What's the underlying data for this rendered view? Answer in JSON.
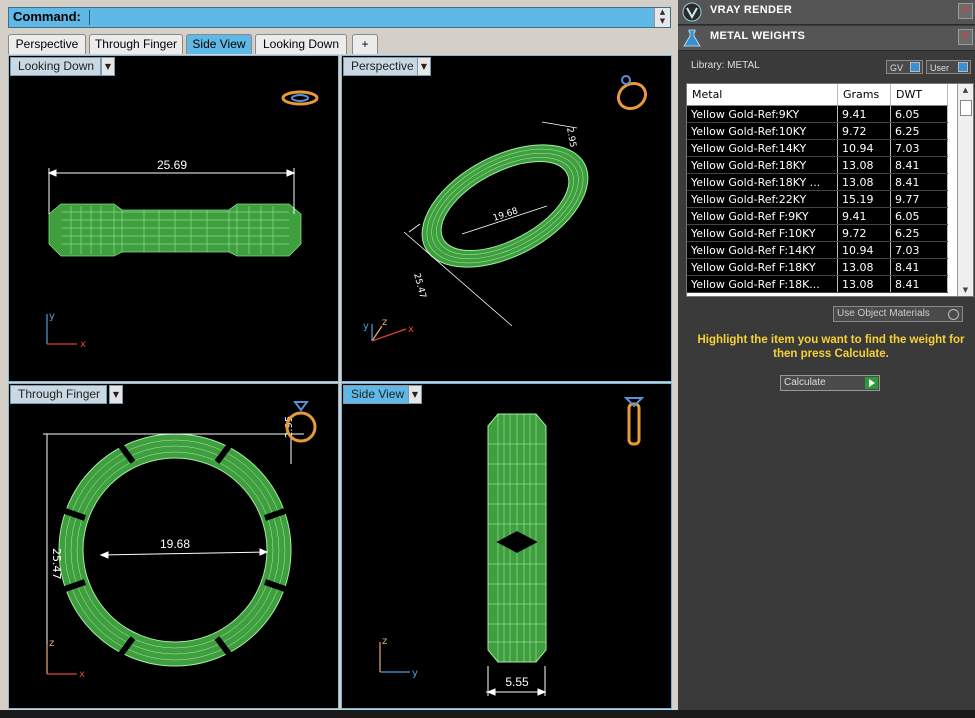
{
  "command": {
    "label": "Command:",
    "value": ""
  },
  "tabs": [
    "Perspective",
    "Through Finger",
    "Side View",
    "Looking Down",
    "+"
  ],
  "active_tab": "Side View",
  "viewports": {
    "top_left": {
      "label": "Looking Down",
      "dimension": "25.69",
      "axes": [
        "y",
        "x"
      ]
    },
    "top_right": {
      "label": "Perspective",
      "dimensions": [
        "19.68",
        "2.95",
        "25.47"
      ],
      "axes": [
        "y",
        "z",
        "x"
      ]
    },
    "bottom_left": {
      "label": "Through Finger",
      "dimensions": [
        "19.68",
        "25.47",
        "2.95"
      ],
      "axes": [
        "z",
        "x"
      ]
    },
    "bottom_right": {
      "label": "Side View",
      "dimension": "5.55",
      "axes": [
        "z",
        "y"
      ]
    }
  },
  "panels": {
    "vray": {
      "title": "VRAY RENDER"
    },
    "metal": {
      "title": "METAL WEIGHTS"
    }
  },
  "library": {
    "label": "Library: METAL",
    "gv_label": "GV",
    "user_label": "User"
  },
  "table": {
    "headers": [
      "Metal",
      "Grams",
      "DWT"
    ],
    "rows": [
      [
        "Yellow Gold-Ref:9KY",
        "9.41",
        "6.05"
      ],
      [
        "Yellow Gold-Ref:10KY",
        "9.72",
        "6.25"
      ],
      [
        "Yellow Gold-Ref:14KY",
        "10.94",
        "7.03"
      ],
      [
        "Yellow Gold-Ref:18KY",
        "13.08",
        "8.41"
      ],
      [
        "Yellow Gold-Ref:18KY ...",
        "13.08",
        "8.41"
      ],
      [
        "Yellow Gold-Ref:22KY",
        "15.19",
        "9.77"
      ],
      [
        "Yellow Gold-Ref F:9KY",
        "9.41",
        "6.05"
      ],
      [
        "Yellow Gold-Ref F:10KY",
        "9.72",
        "6.25"
      ],
      [
        "Yellow Gold-Ref F:14KY",
        "10.94",
        "7.03"
      ],
      [
        "Yellow Gold-Ref F:18KY",
        "13.08",
        "8.41"
      ],
      [
        "Yellow Gold-Ref F:18K...",
        "13.08",
        "8.41"
      ]
    ]
  },
  "use_object_materials": "Use Object Materials",
  "hint": "Highlight the item you want to find the weight for then press Calculate.",
  "calculate_label": "Calculate",
  "colors": {
    "accent": "#5fb8e6",
    "wire": "#6fe06f",
    "hint": "#f7d136",
    "axis_x": "#e0433a",
    "axis_y": "#4aa0e0",
    "axis_z": "#e8b070"
  }
}
